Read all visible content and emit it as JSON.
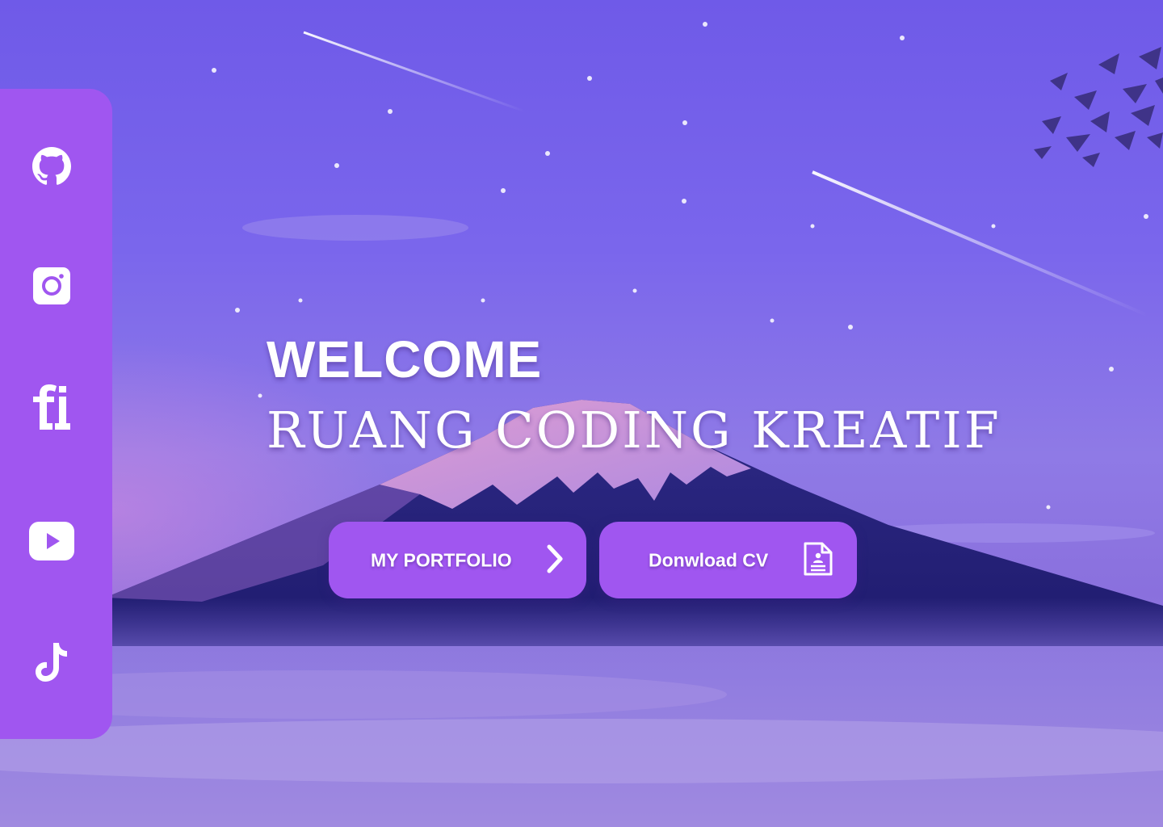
{
  "sidebar": {
    "items": [
      {
        "icon": "github-icon",
        "label": "GitHub"
      },
      {
        "icon": "instagram-icon",
        "label": "Instagram"
      },
      {
        "icon": "fi-icon",
        "label": "fi"
      },
      {
        "icon": "youtube-icon",
        "label": "YouTube"
      },
      {
        "icon": "tiktok-icon",
        "label": "TikTok"
      }
    ]
  },
  "hero": {
    "welcome": "WELCOME",
    "brand": "RUANG CODING KREATIF"
  },
  "buttons": {
    "portfolio_label": "MY PORTFOLIO",
    "portfolio_icon": "chevron-right-icon",
    "cv_label": "Donwload CV",
    "cv_icon": "document-icon"
  },
  "colors": {
    "accent": "#a056f0",
    "sky": "#6f5ae8",
    "text": "#ffffff"
  }
}
